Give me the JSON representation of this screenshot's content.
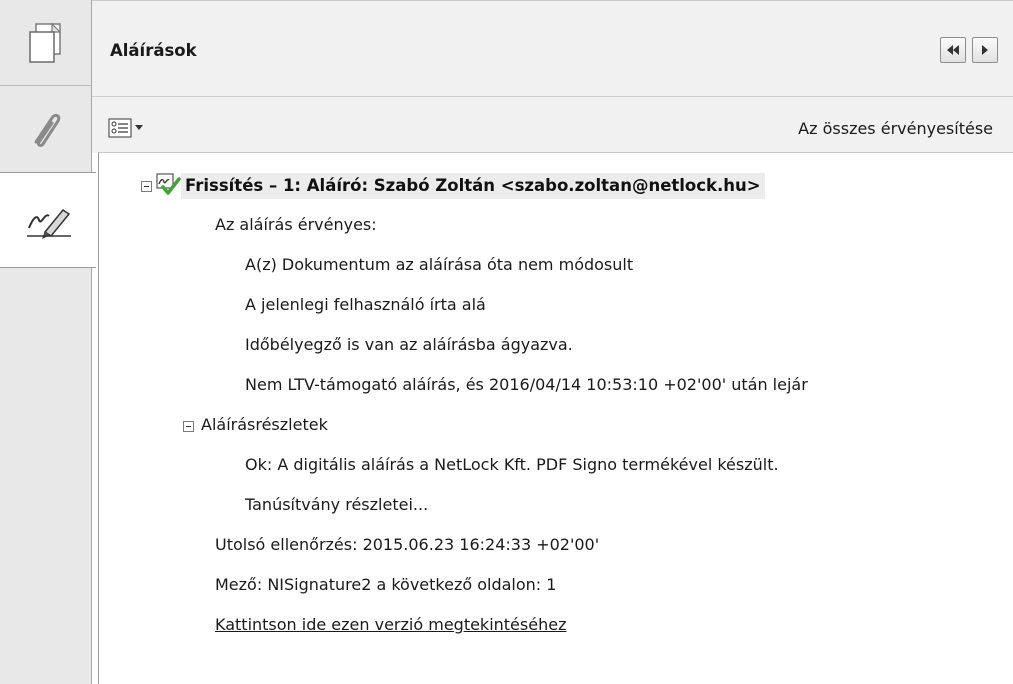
{
  "left_tabs": [
    {
      "icon": "pages-icon"
    },
    {
      "icon": "paperclip-icon"
    },
    {
      "icon": "signature-pen-icon"
    }
  ],
  "panel": {
    "title": "Aláírások",
    "validate_all": "Az összes érvényesítése"
  },
  "signature": {
    "header": "Frissítés – 1: Aláíró: Szabó Zoltán <szabo.zoltan@netlock.hu>",
    "valid_label": "Az aláírás érvényes:",
    "valid_details": [
      "A(z) Dokumentum az aláírása óta nem módosult",
      "A jelenlegi felhasználó írta alá",
      "Időbélyegző is van az aláírásba ágyazva.",
      "Nem LTV-támogató aláírás, és 2016/04/14 10:53:10 +02'00' után lejár"
    ],
    "details_label": "Aláírásrészletek",
    "details": [
      "Ok: A digitális aláírás a NetLock Kft. PDF Signo termékével készült.",
      "Tanúsítvány részletei..."
    ],
    "last_checked": "Utolsó ellenőrzés: 2015.06.23 16:24:33 +02'00'",
    "field": "Mező: NISignature2 a következő oldalon: 1",
    "view_version_link": "Kattintson ide ezen verzió megtekintéséhez"
  }
}
